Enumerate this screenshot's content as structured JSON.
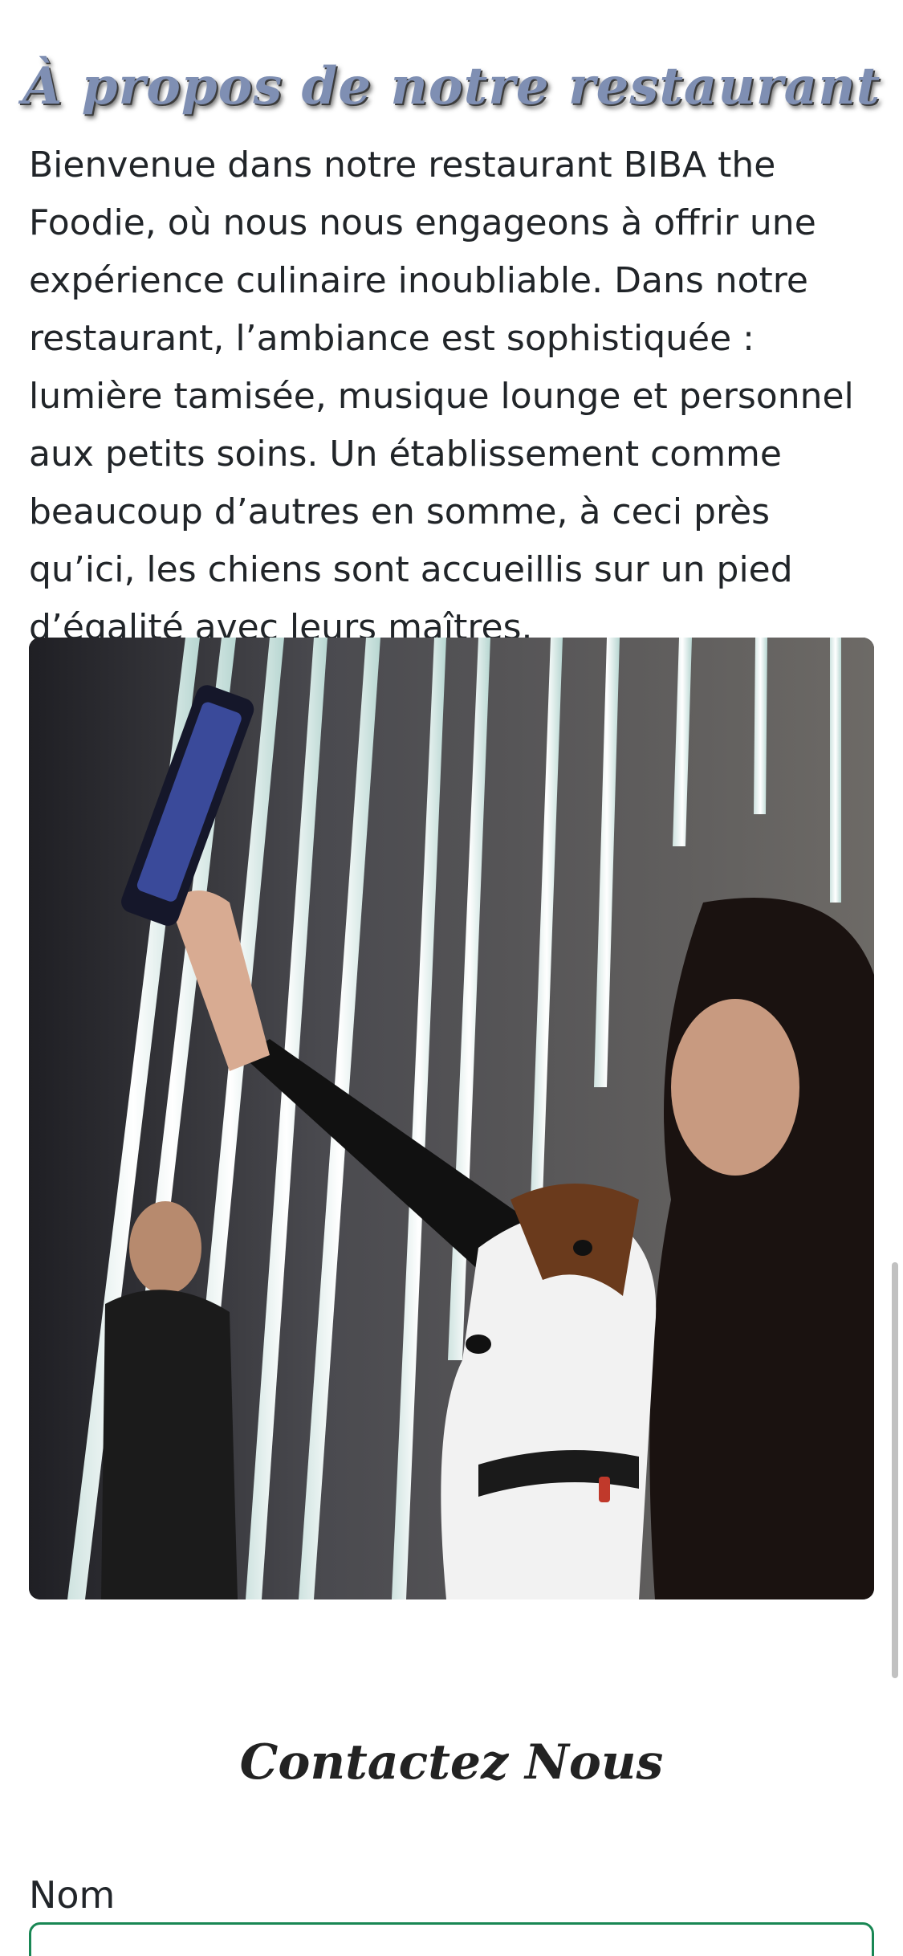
{
  "about": {
    "title": "À propos de notre restaurant",
    "text": "Bienvenue dans notre restaurant BIBA the Foodie, où nous nous engageons à offrir une expérience culinaire inoubliable. Dans notre restaurant, l’ambiance est sophistiquée : lumière tamisée, musique lounge et personnel aux petits soins. Un établissement comme beaucoup d’autres en somme, à ceci près qu’ici, les chiens sont accueillis sur un pied d’égalité avec leurs maîtres."
  },
  "contact": {
    "title": "Contactez Nous",
    "name_label": "Nom",
    "name_value": ""
  },
  "colors": {
    "title_gradient": "#7f8fb3",
    "input_border": "#198754",
    "text": "#212529"
  }
}
